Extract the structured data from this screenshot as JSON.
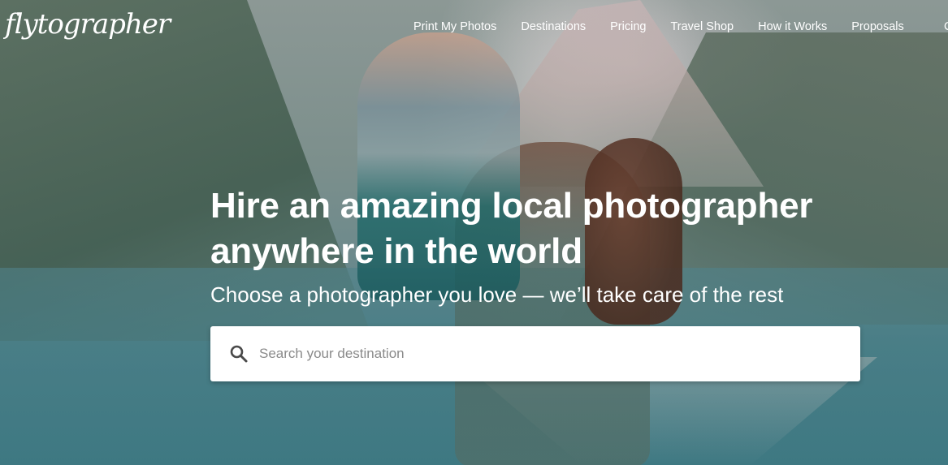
{
  "brand": {
    "logo_text": "flytographer"
  },
  "nav": {
    "items": [
      {
        "label": "Print My Photos"
      },
      {
        "label": "Destinations"
      },
      {
        "label": "Pricing"
      },
      {
        "label": "Travel Shop"
      },
      {
        "label": "How it Works"
      },
      {
        "label": "Proposals"
      }
    ],
    "clipped_item": "C"
  },
  "hero": {
    "headline": "Hire an amazing local photographer anywhere in the world",
    "subheadline": "Choose a photographer you love — we’ll take care of the rest",
    "background_image": "mother-lifting-child-by-mountain-lake"
  },
  "search": {
    "placeholder": "Search your destination",
    "value": "",
    "icon": "search-icon"
  },
  "colors": {
    "text": "#ffffff",
    "search_bg": "#ffffff",
    "placeholder": "#8a8a8a",
    "icon": "#4a4a4a"
  }
}
